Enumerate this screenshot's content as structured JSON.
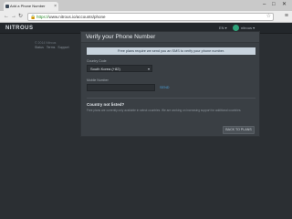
{
  "browser": {
    "tab_title": "Add a Phone Number",
    "url_scheme": "https://",
    "url_rest": "www.nitrous.io/accounts/phone",
    "window_controls": [
      "–",
      "□",
      "✕"
    ]
  },
  "app": {
    "logo": "NITROUS",
    "lang_selector": "EN ▾",
    "username": "nitrous ▾"
  },
  "sidebar": {
    "title": "© 2014 Nitrous",
    "links": [
      "Status",
      "Terms",
      "Support"
    ]
  },
  "panel": {
    "title": "Verify your Phone Number",
    "notice": "Free plans require we send you an SMS to verify your phone number.",
    "country_label": "Country Code",
    "country_value": "South Korea (+82)",
    "phone_label": "Mobile Number",
    "phone_value": "",
    "send_link": "SEND",
    "question_title": "Country not listed?",
    "question_text": "Free plans are currently only available in select countries. We are working on increasing support for additional countries.",
    "back_button": "BACK TO PLANS"
  }
}
